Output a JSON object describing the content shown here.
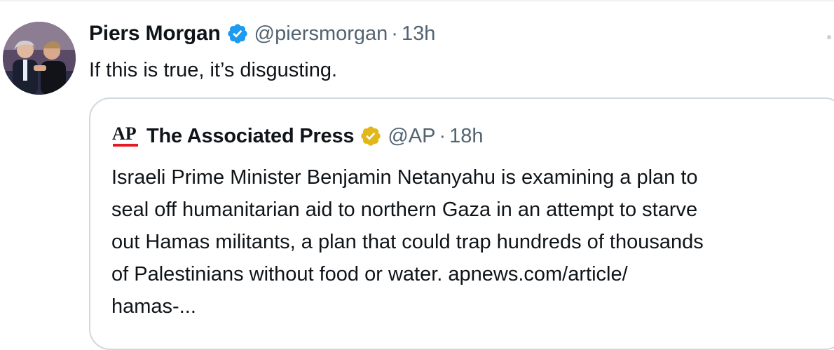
{
  "tweet": {
    "author": {
      "display_name": "Piers Morgan",
      "handle": "@piersmorgan",
      "verified_badge": "blue-verified-badge-icon"
    },
    "separator": "·",
    "time": "13h",
    "text": "If this is true, it’s disgusting.",
    "more_icon": "more-icon"
  },
  "quote": {
    "logo_text": "AP",
    "author": {
      "display_name": "The Associated Press",
      "handle": "@AP",
      "verified_badge": "gold-verified-badge-icon"
    },
    "separator": "·",
    "time": "18h",
    "text_lines": [
      "Israeli Prime Minister Benjamin Netanyahu is examining a plan to",
      "seal off humanitarian aid to northern Gaza in an attempt to starve",
      "out Hamas militants, a plan that could trap hundreds of thousands",
      "of Palestinians without food or water. apnews.com/article/",
      "hamas-..."
    ]
  },
  "colors": {
    "text_primary": "#0f1419",
    "text_secondary": "#536471",
    "verified_blue": "#1d9bf0",
    "verified_gold": "#e2b719",
    "ap_red": "#e31b23",
    "border": "#cfd9de"
  }
}
